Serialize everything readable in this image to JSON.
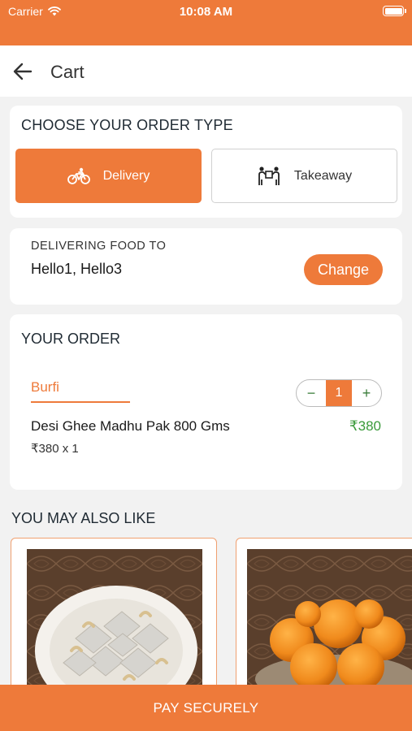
{
  "status_bar": {
    "carrier": "Carrier",
    "time": "10:08 AM"
  },
  "header": {
    "title": "Cart",
    "back_icon": "arrow-left-icon"
  },
  "order_type": {
    "heading": "CHOOSE YOUR ORDER TYPE",
    "options": [
      {
        "label": "Delivery",
        "icon": "bicycle-icon",
        "selected": true
      },
      {
        "label": "Takeaway",
        "icon": "takeaway-icon",
        "selected": false
      }
    ]
  },
  "delivery_address": {
    "label": "DELIVERING FOOD TO",
    "value": "Hello1, Hello3",
    "change_label": "Change"
  },
  "your_order": {
    "heading": "YOUR ORDER",
    "category": "Burfi",
    "items": [
      {
        "name": "Desi Ghee Madhu Pak 800 Gms",
        "price": "₹380",
        "qty_text": "₹380 x 1",
        "quantity": "1"
      }
    ],
    "stepper": {
      "minus": "−",
      "plus": "+"
    }
  },
  "recommendations": {
    "heading": "YOU MAY ALSO LIKE",
    "products": [
      {
        "image": "kaju-katli-image"
      },
      {
        "image": "laddoo-image"
      }
    ]
  },
  "footer": {
    "pay_label": "PAY SECURELY"
  },
  "colors": {
    "accent": "#ee7a3a",
    "price_green": "#3a9a3a",
    "background": "#f2f2f2"
  }
}
